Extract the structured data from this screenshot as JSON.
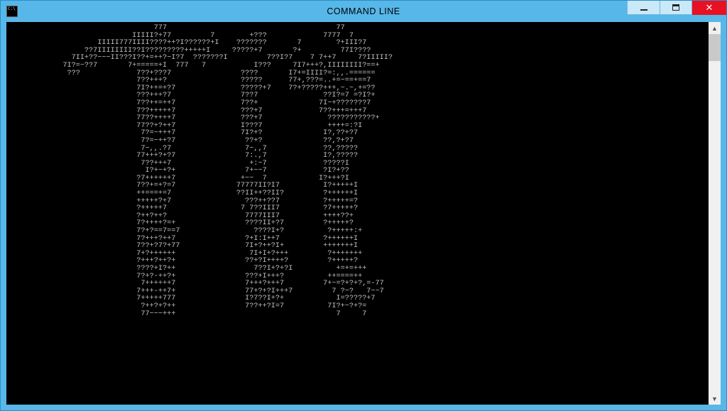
{
  "window": {
    "title": "COMMAND LINE",
    "app_icon_text": "C:\\"
  },
  "controls": {
    "minimize_tooltip": "Minimize",
    "maximize_tooltip": "Maximize",
    "close_tooltip": "Close"
  },
  "scrollbar": {
    "up": "▲",
    "down": "▼"
  },
  "terminal": {
    "ascii_art": "                                 777                                       77\n                            IIIII?+77         7        +???             7777  7\n                    IIIII777IIII????++?I??????+I    ???????       7        ?+III?7\n                 ??7IIIIIIII??I?????????+++++I     ?????+7       ?+         77I????\n              7II+??~~~II???I??+=++?~I?7  ???????I         7??I?7    7 7++7     7?IIIII?\n            7I?=~??7       7+=====+I  777   7           I???     7I7+++?,IIIIIIII?==+\n             ???             7??+???7                ????       I7+=IIII?=:,,.======\n                             7??+++?                 ?????      77+,???=..+=~==+==7\n                             7I?++=+?7               ?????+7    7?+?????+++,~.~,+=??\n                             ???+++?7                7??7               ??I?=7 =?I?+\n                             7??++=++7               7??+              7I~+???????7\n                             7??+++++7               ???+7             7??+++=+++7\n                             77??++++7               ???+7               ???????????+\n                             77??+?++7               I???7               ++++=:?I\n                              7?=~+++7               7I?+?              I?,??+?7\n                              7?=~++?7                ??+?              ??,?+?7\n                              7~,,.?7                 7~,,7             ??,?????\n                             77+++?+?7                7:.,7             I?,?????\n                              7??+++7                  +:~7             ?????I\n                               I?+~+?+                7+~~7             ?I?+??\n                             ?7++++++7               +~~  7            I?+++?I\n                             7??+=+?=7              77777II?I7          I?+++++I\n                             ++===+=7               ??II++??II?         ?++++++I\n                             +++++?+7                 ???++??7          ?+++++=?\n                             ?+++++7                 7 7??III7          ?7+++++?\n                             ?++?++?                  7777III7          ++++??+\n                             7?++++?=+                ????II+?7         ?+++++?\n                             7?+?==7==7                 ????I+?          ?+++++:+\n                             7?+++?++7                ?+I:I++7          ?++++++I\n                             7??+?7?+77               7I+?++?I+         +++++++I\n                             7+?++++++                 7I+I+?+++         ?+++++++\n                             ?+++?++?+                ??+?I++++?         ?+++++?\n                             ????+I?++                  7??I+?+?I          +=+=+++\n                             7?+?-++?+                ???+I+++?          ++====++\n                              7++++++7                7+++?+++7         7+~=?+?+?,=-77\n                             7+++-++7+                77+?+?I+++7         7 ?~?   7~~7\n                             7+++++777                I?7??I+?+            I=?????+7\n                              ?++?+?++                7??++?I=7          7I?+~?+?=\n                              77~~~+++                                     7     7"
  }
}
